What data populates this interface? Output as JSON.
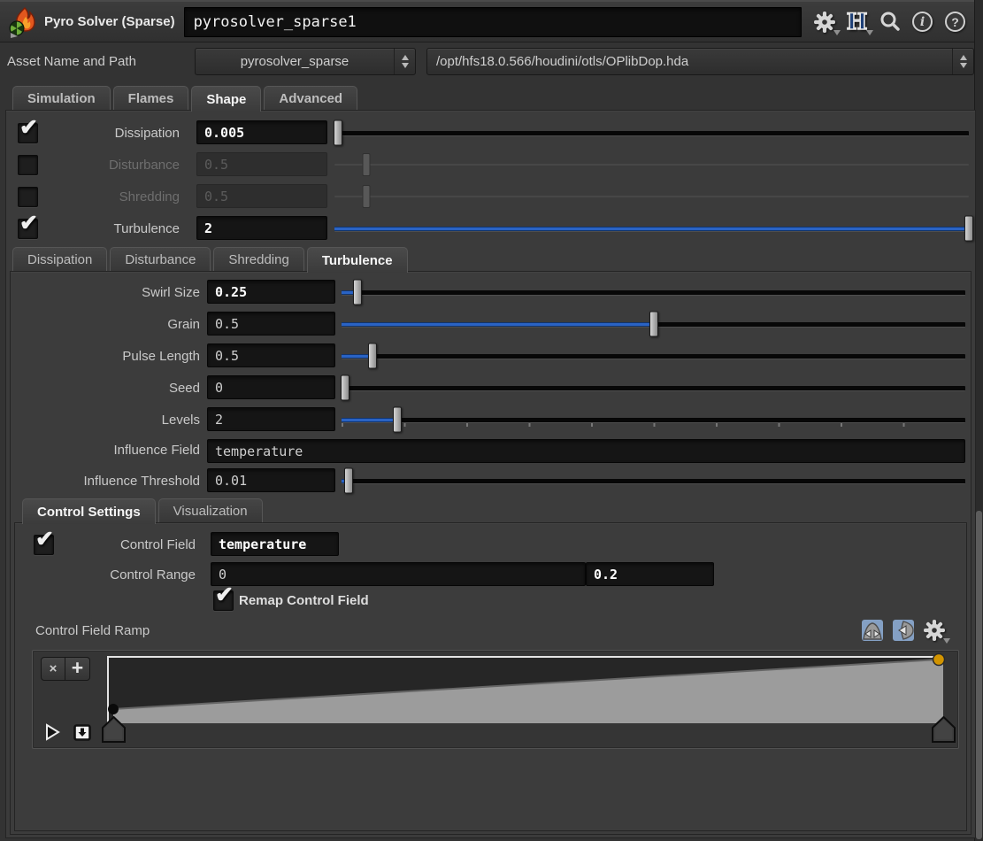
{
  "header": {
    "title": "Pyro Solver (Sparse)",
    "node_name": "pyrosolver_sparse1",
    "icons": [
      "gear-menu",
      "houdini-logo",
      "search",
      "info",
      "help"
    ],
    "info_glyph": "i",
    "help_glyph": "?",
    "logo_glyph": "H"
  },
  "asset": {
    "label": "Asset Name and Path",
    "name": "pyrosolver_sparse",
    "path": "/opt/hfs18.0.566/houdini/otls/OPlibDop.hda"
  },
  "main_tabs": [
    {
      "label": "Simulation",
      "active": false
    },
    {
      "label": "Flames",
      "active": false
    },
    {
      "label": "Shape",
      "active": true
    },
    {
      "label": "Advanced",
      "active": false
    }
  ],
  "sim_params": [
    {
      "label": "Dissipation",
      "check": "✔",
      "value": "0.005",
      "bold": true,
      "disabled": false,
      "slider": {
        "pos": "0.5%",
        "fill": "0%"
      }
    },
    {
      "label": "Disturbance",
      "check": "",
      "value": "0.5",
      "bold": false,
      "disabled": true,
      "slider": {
        "pos": "5%",
        "fill": "0%"
      }
    },
    {
      "label": "Shredding",
      "check": "",
      "value": "0.5",
      "bold": false,
      "disabled": true,
      "slider": {
        "pos": "5%",
        "fill": "0%"
      }
    },
    {
      "label": "Turbulence",
      "check": "✔",
      "value": "2",
      "bold": true,
      "disabled": false,
      "slider": {
        "pos": "100%",
        "fill": "100%"
      }
    }
  ],
  "sub_tabs": [
    {
      "label": "Dissipation",
      "active": false
    },
    {
      "label": "Disturbance",
      "active": false
    },
    {
      "label": "Shredding",
      "active": false
    },
    {
      "label": "Turbulence",
      "active": true
    }
  ],
  "turb_params": [
    {
      "label": "Swirl Size",
      "value": "0.25",
      "bold": true,
      "slider": {
        "pos": "2.5%",
        "fill": "2.5%"
      }
    },
    {
      "label": "Grain",
      "value": "0.5",
      "bold": false,
      "slider": {
        "pos": "50%",
        "fill": "50%"
      }
    },
    {
      "label": "Pulse Length",
      "value": "0.5",
      "bold": false,
      "slider": {
        "pos": "5%",
        "fill": "5%"
      }
    },
    {
      "label": "Seed",
      "value": "0",
      "bold": false,
      "slider": {
        "pos": "0.5%",
        "fill": "0%"
      }
    },
    {
      "label": "Levels",
      "value": "2",
      "bold": false,
      "slider": {
        "pos": "9%",
        "fill": "9%",
        "ticks": true
      }
    },
    {
      "label": "Influence Field",
      "value": "temperature",
      "bold": false
    },
    {
      "label": "Influence Threshold",
      "value": "0.01",
      "bold": false,
      "slider": {
        "pos": "1.2%",
        "fill": "1.2%"
      }
    }
  ],
  "control_tabs": [
    {
      "label": "Control Settings",
      "active": true
    },
    {
      "label": "Visualization",
      "active": false
    }
  ],
  "control": {
    "field_check": "✔",
    "field_label": "Control Field",
    "field_value": "temperature",
    "range_label": "Control Range",
    "range_min": "0",
    "range_max": "0.2",
    "remap_check": "✔",
    "remap_label": "Remap Control Field"
  },
  "ramp": {
    "label": "Control Field Ramp",
    "delete_label": "×",
    "add_label": "+",
    "fill_color": "#9c9c9c",
    "edge_color": "#666666",
    "keys": [
      {
        "position": 0,
        "value": 0.2,
        "color": "#0a0a0a",
        "selected": false
      },
      {
        "position": 1,
        "value": 1.0,
        "color": "#d29400",
        "selected": true
      }
    ]
  },
  "colors": {
    "accent_blue": "#2a63c4",
    "selected_key_orange": "#d29400",
    "panel_bg": "#3b3b3b"
  }
}
